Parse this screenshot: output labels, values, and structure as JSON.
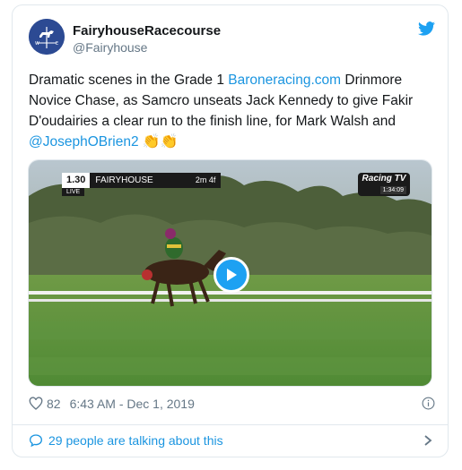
{
  "tweet": {
    "display_name": "FairyhouseRacecourse",
    "handle": "@Fairyhouse",
    "text_before_link": "Dramatic scenes in the Grade 1 ",
    "link_text": "Baroneracing.com",
    "text_middle": " Drinmore Novice Chase, as Samcro unseats Jack Kennedy to give Fakir D'oudairies a clear run to the finish line, for Mark Walsh and ",
    "mention": "@JosephOBrien2",
    "emoji": "👏👏"
  },
  "video": {
    "race_time": "1.30",
    "track": "FAIRYHOUSE",
    "distance": "2m 4f",
    "live_label": "LIVE",
    "channel": "Racing TV",
    "clock": "1:34:09"
  },
  "footer": {
    "likes": "82",
    "timestamp": "6:43 AM - Dec 1, 2019",
    "talking": "29 people are talking about this"
  },
  "colors": {
    "link": "#1b95e0",
    "play_button": "#1da1f2",
    "grass": "#5c8f3a"
  },
  "icons": [
    "twitter-bird-icon",
    "heart-icon",
    "info-icon",
    "reply-bubble-icon",
    "chevron-right-icon",
    "play-icon"
  ]
}
